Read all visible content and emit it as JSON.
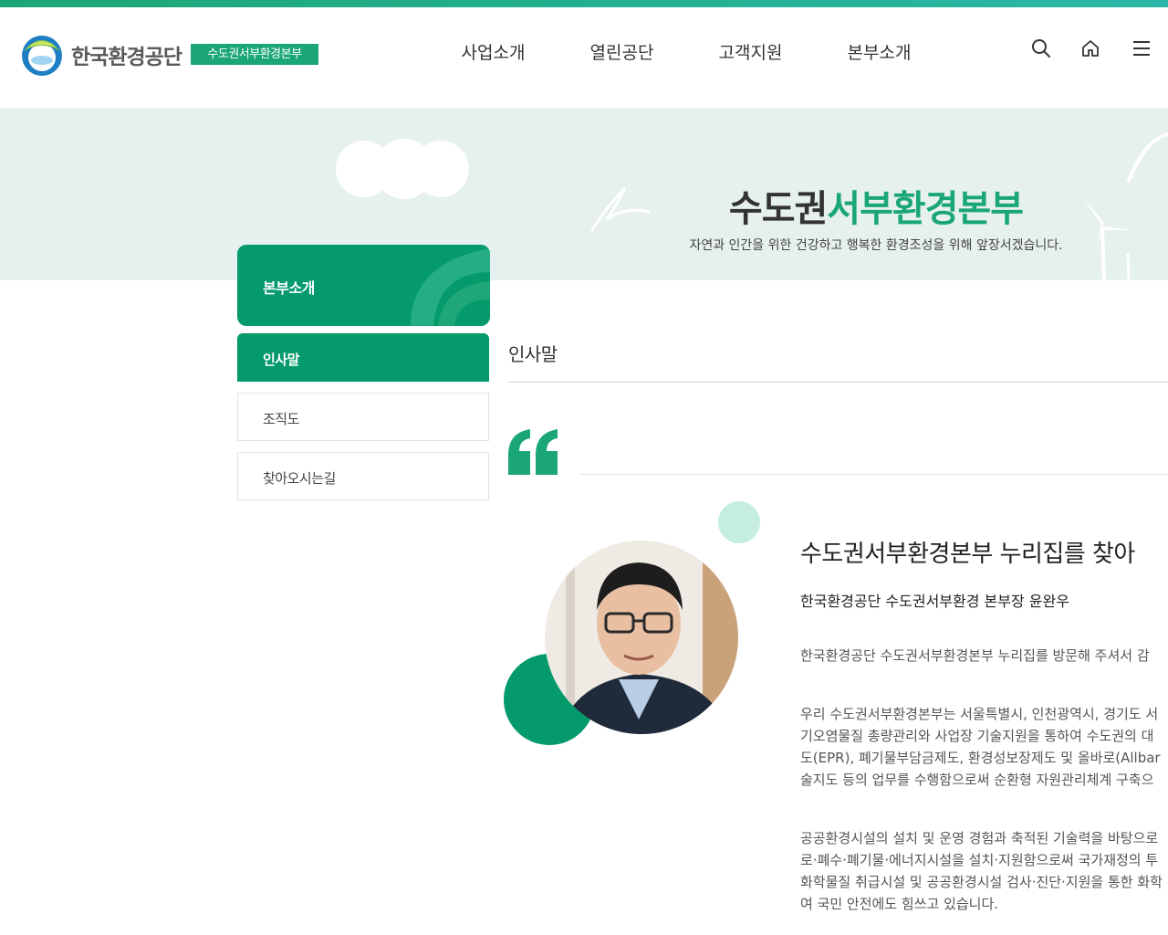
{
  "header": {
    "logo_text": "한국환경공단",
    "badge": "수도권서부환경본부",
    "nav": [
      "사업소개",
      "열린공단",
      "고객지원",
      "본부소개"
    ],
    "icons": [
      "search-icon",
      "home-icon",
      "menu-icon"
    ]
  },
  "hero": {
    "title_plain": "수도권",
    "title_accent": "서부환경본부",
    "subtitle": "자연과 인간을 위한 건강하고 행복한 환경조성을 위해 앞장서겠습니다."
  },
  "sidebar": {
    "title": "본부소개",
    "items": [
      {
        "label": "인사말",
        "active": true
      },
      {
        "label": "조직도",
        "active": false
      },
      {
        "label": "찾아오시는길",
        "active": false
      }
    ]
  },
  "content": {
    "page_title": "인사말",
    "greeting_title": "수도권서부환경본부 누리집를 찾아",
    "signature": "한국환경공단 수도권서부환경 본부장 윤완우",
    "para1": [
      "한국환경공단 수도권서부환경본부 누리집를 방문해 주셔서 감"
    ],
    "para2": [
      "우리 수도권서부환경본부는 서울특별시, 인천광역시, 경기도 서",
      "기오염물질 총량관리와 사업장 기술지원을 통하여 수도권의 대",
      "도(EPR), 폐기물부담금제도, 환경성보장제도 및 올바로(Allbar",
      "술지도 등의 업무를 수행함으로써 순환형 자원관리체계 구축으"
    ],
    "para3": [
      "공공환경시설의 설치 및 운영 경험과 축적된 기술력을 바탕으로",
      "로·폐수·폐기물·에너지시설을 설치·지원함으로써 국가재정의 투",
      "화학물질 취급시설 및 공공환경시설 검사·진단·지원을 통한 화학",
      "여 국민 안전에도 힘쓰고 있습니다."
    ]
  },
  "colors": {
    "accent": "#1aa775",
    "sidebar_green": "#049a6c",
    "hero_bg": "#e6f1ef"
  }
}
